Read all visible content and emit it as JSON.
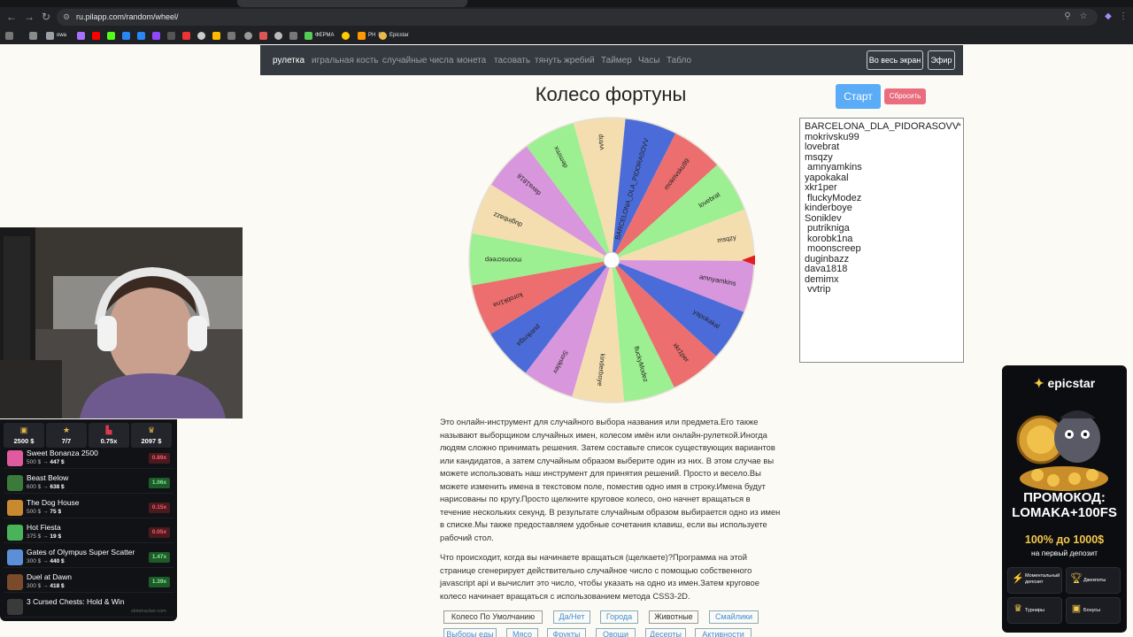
{
  "browser": {
    "url": "ru.pilapp.com/random/wheel/",
    "bookmarks": [
      "owa",
      "ФЕРМА",
      "PH",
      "B",
      "Epicstar"
    ]
  },
  "site": {
    "nav": [
      "рулетка",
      "игральная кость",
      "случайные числа",
      "монета",
      "тасовать",
      "тянуть жребий",
      "Таймер",
      "Часы",
      "Табло"
    ],
    "fullscreen_label": "Во весь экран",
    "broadcast_label": "Эфир",
    "title": "Колесо фортуны",
    "start_label": "Старт",
    "reset_label": "Сбросить",
    "names": [
      "BARCELONA_DLA_PIDORASOVV",
      "mokrivsku99",
      "lovebrat",
      "msqzy",
      " amnyamkins",
      "yapokakal",
      "xkr1per",
      " fluckyModez",
      "kinderboye",
      "Soniklev",
      " putrikniga",
      " korobk1na",
      " moonscreep",
      "duginbazz",
      "dava1818",
      "demimx",
      " vvtrip"
    ],
    "wheel_labels": [
      "vvtrip",
      "BARCELONA_DLA_PIDORASOVV",
      "mokrivsku99",
      "lovebrat",
      "msqzy",
      "amnyamkins",
      "yapokakal",
      "xkr1per",
      "fluckyModez",
      "kinderboye",
      "Soniklev",
      "putrikniga",
      "korobk1na",
      "moonscreep",
      "duginbazz",
      "dava1818",
      "demimx"
    ],
    "wheel_colors": [
      "#f4deb0",
      "#4b6cd8",
      "#ec6e6e",
      "#9cf091",
      "#f4deb0",
      "#d896dc",
      "#4b6cd8",
      "#ec6e6e",
      "#9cf091",
      "#f4deb0",
      "#d896dc",
      "#4b6cd8",
      "#ec6e6e",
      "#9cf091",
      "#f4deb0",
      "#d896dc",
      "#9cf091"
    ],
    "pointer_color": "#e0201e",
    "description": [
      "Это онлайн-инструмент для случайного выбора названия или предмета.Его также называют выборщиком случайных имен, колесом имён или онлайн-рулеткой.Иногда людям сложно принимать решения. Затем составьте список существующих вариантов или кандидатов, а затем случайным образом выберите один из них. В этом случае вы можете использовать наш инструмент для принятия решений. Просто и весело.Вы можете изменить имена в текстовом поле, поместив одно имя в строку.Имена будут нарисованы по кругу.Просто щелкните круговое колесо, оно начнет вращаться в течение нескольких секунд. В результате случайным образом выбирается одно из имен в списке.Мы также предоставляем удобные сочетания клавиш, если вы используете рабочий стол.",
      "Что происходит, когда вы начинаете вращаться (щелкаете)?Программа на этой странице сгенерирует действительно случайное число с помощью собственного javascript api и вычислит это число, чтобы указать на одно из имен.Затем круговое колесо начинает вращаться с использованием метода CSS3-2D."
    ],
    "categories": [
      "Колесо По Умолчанию",
      "Да/Нет",
      "Города",
      "Животные",
      "Смайлики",
      "Выборы еды",
      "Мясо",
      "Фрукты",
      "Овощи",
      "Десерты",
      "Активности"
    ]
  },
  "overlay": {
    "stats": [
      "2500 $",
      "7/7",
      "0.75x",
      "2097 $"
    ],
    "slots": [
      {
        "name": "Sweet Bonanza 2500",
        "bet": "500 $",
        "win": "447 $",
        "multi": "0.89x",
        "up": false,
        "color": "#e05aa0"
      },
      {
        "name": "Beast Below",
        "bet": "600 $",
        "win": "638 $",
        "multi": "1.06x",
        "up": true,
        "color": "#3a7a3a"
      },
      {
        "name": "The Dog House",
        "bet": "500 $",
        "win": "75 $",
        "multi": "0.15x",
        "up": false,
        "color": "#c9892f"
      },
      {
        "name": "Hot Fiesta",
        "bet": "375 $",
        "win": "19 $",
        "multi": "0.05x",
        "up": false,
        "color": "#49b35a"
      },
      {
        "name": "Gates of Olympus Super Scatter",
        "bet": "300 $",
        "win": "440 $",
        "multi": "1.47x",
        "up": true,
        "color": "#5c8fd8"
      },
      {
        "name": "Duel at Dawn",
        "bet": "300 $",
        "win": "418 $",
        "multi": "1.39x",
        "up": true,
        "color": "#7a4a2a"
      },
      {
        "name": "3 Cursed Chests: Hold & Win",
        "bet": "",
        "win": "",
        "multi": "",
        "up": true,
        "color": "#3a3a3a"
      }
    ],
    "footer": "slotstracker.com"
  },
  "promo": {
    "brand": "epicstar",
    "line1": "ПРОМОКОД:",
    "line2": "LOMAKA+100FS",
    "bonus": "100% до 1000$",
    "bonus_sub": "на первый депозит",
    "tiles": [
      "Моментальный депозит",
      "Джекпоты",
      "Турниры",
      "Бонусы"
    ]
  }
}
